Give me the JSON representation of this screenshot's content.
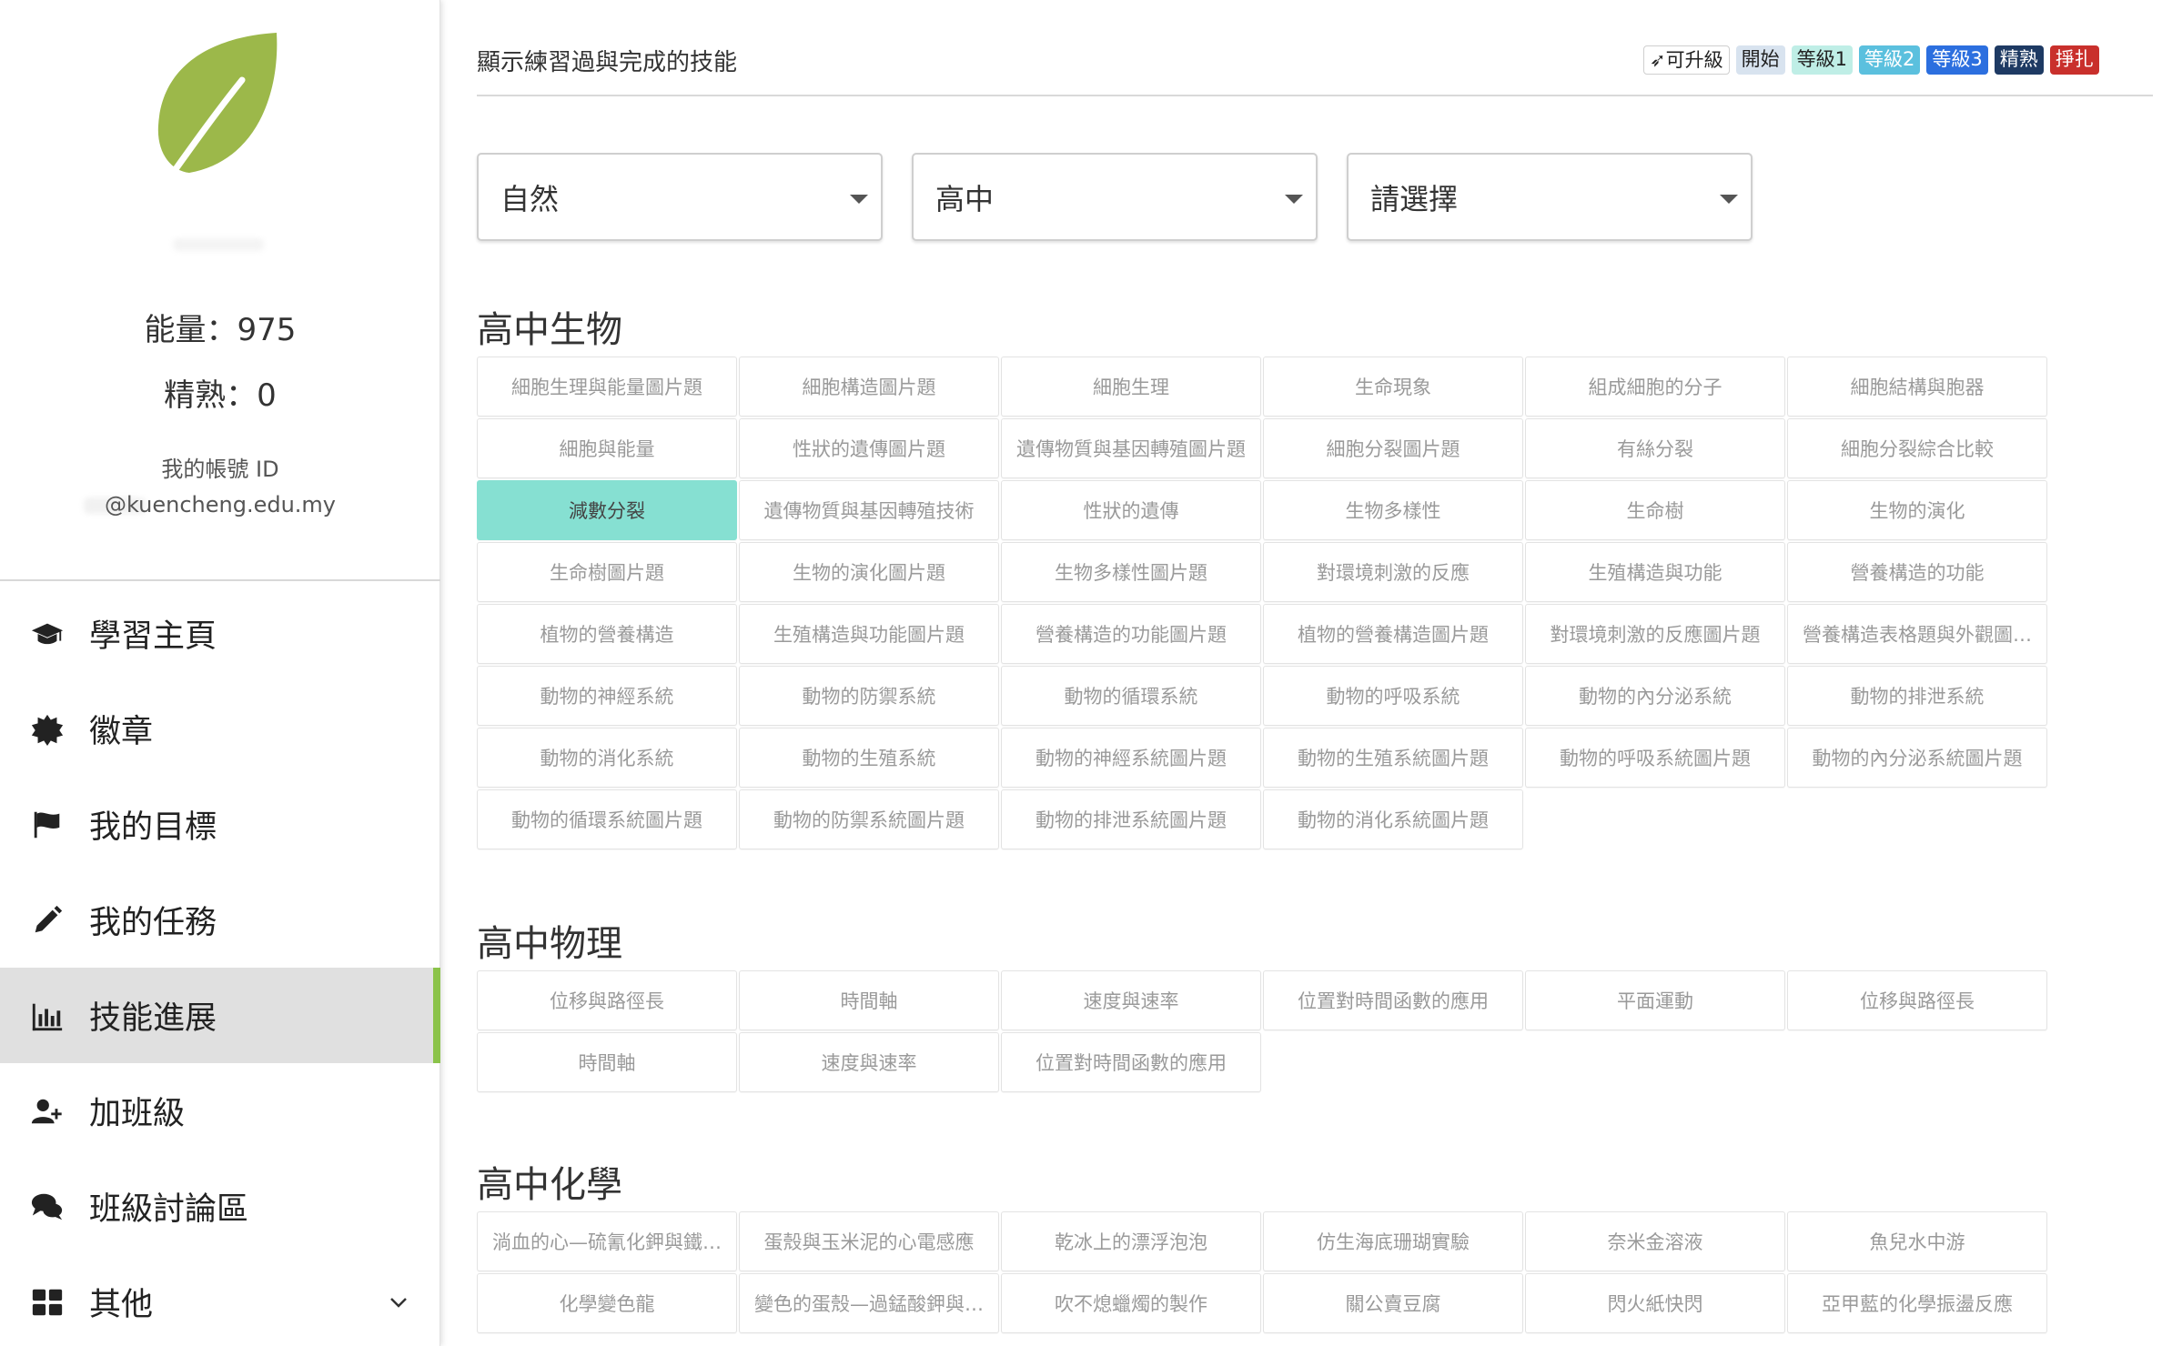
{
  "sidebar": {
    "energy": "能量：975",
    "mastery": "精熟：0",
    "account_label": "我的帳號 ID",
    "account_email": "@kuencheng.edu.my",
    "nav": [
      {
        "label": "學習主頁",
        "icon": "graduation-cap-icon",
        "active": false
      },
      {
        "label": "徽章",
        "icon": "badge-icon",
        "active": false
      },
      {
        "label": "我的目標",
        "icon": "flag-icon",
        "active": false
      },
      {
        "label": "我的任務",
        "icon": "pencil-icon",
        "active": false
      },
      {
        "label": "技能進展",
        "icon": "bar-chart-icon",
        "active": true
      },
      {
        "label": "加班級",
        "icon": "add-user-icon",
        "active": false
      },
      {
        "label": "班級討論區",
        "icon": "comments-icon",
        "active": false
      },
      {
        "label": "其他",
        "icon": "grid-icon",
        "active": false,
        "has_chevron": true
      }
    ]
  },
  "header": {
    "title": "顯示練習過與完成的技能",
    "legend": {
      "upgrade": "可升級",
      "start": "開始",
      "level1": "等級1",
      "level2": "等級2",
      "level3": "等級3",
      "mastered": "精熟",
      "struggle": "掙扎"
    }
  },
  "filters": {
    "subject": "自然",
    "grade": "高中",
    "topic": "請選擇"
  },
  "sections": [
    {
      "title": "高中生物",
      "skills": [
        "細胞生理與能量圖片題",
        "細胞構造圖片題",
        "細胞生理",
        "生命現象",
        "組成細胞的分子",
        "細胞結構與胞器",
        "細胞與能量",
        "性狀的遺傳圖片題",
        "遺傳物質與基因轉殖圖片題",
        "細胞分裂圖片題",
        "有絲分裂",
        "細胞分裂綜合比較",
        "減數分裂",
        "遺傳物質與基因轉殖技術",
        "性狀的遺傳",
        "生物多樣性",
        "生命樹",
        "生物的演化",
        "生命樹圖片題",
        "生物的演化圖片題",
        "生物多樣性圖片題",
        "對環境刺激的反應",
        "生殖構造與功能",
        "營養構造的功能",
        "植物的營養構造",
        "生殖構造與功能圖片題",
        "營養構造的功能圖片題",
        "植物的營養構造圖片題",
        "對環境刺激的反應圖片題",
        "營養構造表格題與外觀圖…",
        "動物的神經系統",
        "動物的防禦系統",
        "動物的循環系統",
        "動物的呼吸系統",
        "動物的內分泌系統",
        "動物的排泄系統",
        "動物的消化系統",
        "動物的生殖系統",
        "動物的神經系統圖片題",
        "動物的生殖系統圖片題",
        "動物的呼吸系統圖片題",
        "動物的內分泌系統圖片題",
        "動物的循環系統圖片題",
        "動物的防禦系統圖片題",
        "動物的排泄系統圖片題",
        "動物的消化系統圖片題"
      ],
      "active_index": 12
    },
    {
      "title": "高中物理",
      "skills": [
        "位移與路徑長",
        "時間軸",
        "速度與速率",
        "位置對時間函數的應用",
        "平面運動",
        "位移與路徑長",
        "時間軸",
        "速度與速率",
        "位置對時間函數的應用"
      ],
      "active_index": -1
    },
    {
      "title": "高中化學",
      "skills": [
        "淌血的心—硫氰化鉀與鐵…",
        "蛋殼與玉米泥的心電感應",
        "乾冰上的漂浮泡泡",
        "仿生海底珊瑚實驗",
        "奈米金溶液",
        "魚兒水中游",
        "化學變色龍",
        "變色的蛋殼—過錳酸鉀與…",
        "吹不熄蠟燭的製作",
        "關公賣豆腐",
        "閃火紙快閃",
        "亞甲藍的化學振盪反應"
      ],
      "active_index": -1
    }
  ],
  "colors": {
    "accent": "#8bc34a",
    "active_skill": "#86e0d2",
    "level2": "#5bc0de",
    "level3": "#2c6fdf",
    "mastered": "#1e3a63",
    "struggle": "#c9302c"
  }
}
